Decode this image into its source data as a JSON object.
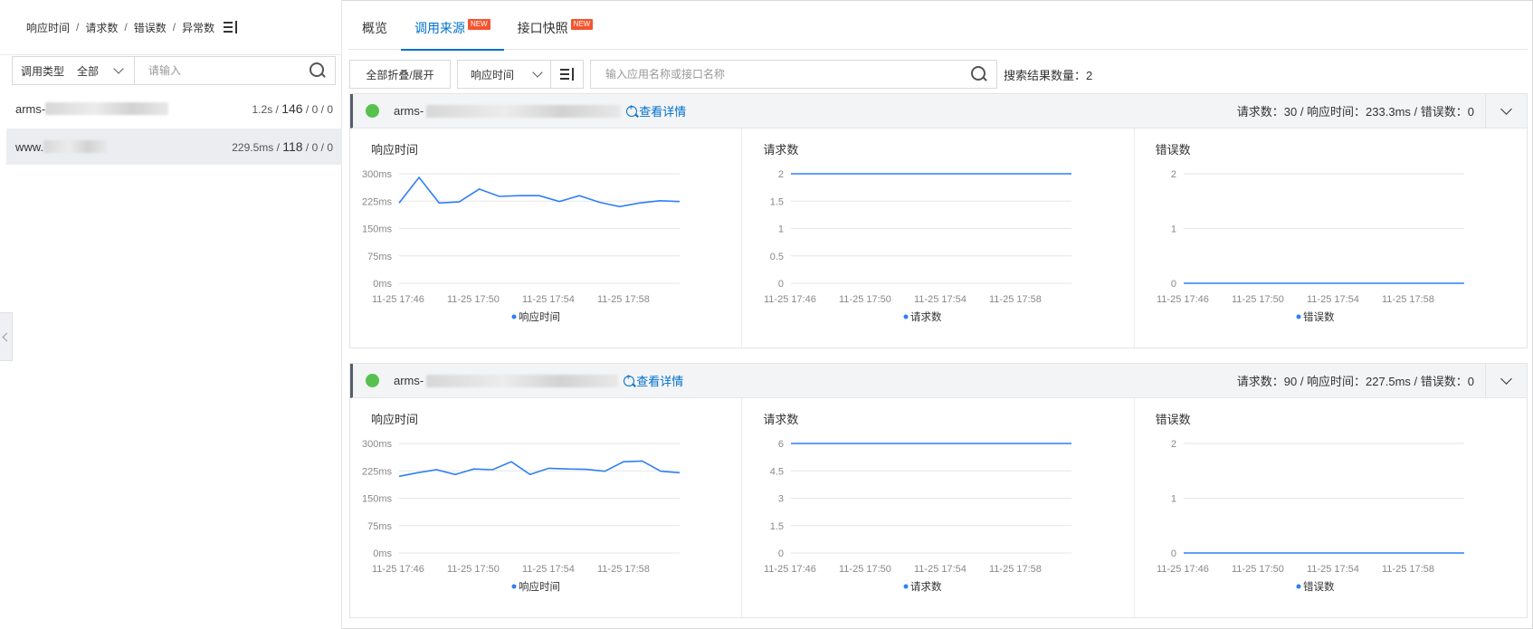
{
  "left": {
    "header": {
      "items": [
        "响应时间",
        "请求数",
        "错误数",
        "异常数"
      ],
      "sep": "/"
    },
    "filter": {
      "type_label": "调用类型",
      "type_value": "全部",
      "placeholder": "请输入"
    },
    "apps": [
      {
        "name_prefix": "arms-",
        "rt": "1.2s",
        "req": "146",
        "err": "0",
        "exc": "0",
        "selected": false
      },
      {
        "name_prefix": "www.",
        "rt": "229.5ms",
        "req": "118",
        "err": "0",
        "exc": "0",
        "selected": true
      }
    ]
  },
  "tabs": [
    {
      "label": "概览",
      "new": ""
    },
    {
      "label": "调用来源",
      "new": "NEW"
    },
    {
      "label": "接口快照",
      "new": "NEW"
    }
  ],
  "toolbar": {
    "fold_label": "全部折叠/展开",
    "sort_value": "响应时间",
    "search_placeholder": "输入应用名称或接口名称",
    "result_label": "搜索结果数量：",
    "result_count": "2"
  },
  "cards": [
    {
      "name_prefix": "arms-",
      "detail_label": "查看详情",
      "stats": "请求数：30 / 响应时间：233.3ms / 错误数：0",
      "charts": [
        {
          "title": "响应时间",
          "legend": "响应时间"
        },
        {
          "title": "请求数",
          "legend": "请求数"
        },
        {
          "title": "错误数",
          "legend": "错误数"
        }
      ]
    },
    {
      "name_prefix": "arms-",
      "detail_label": "查看详情",
      "stats": "请求数：90 / 响应时间：227.5ms / 错误数：0",
      "charts": [
        {
          "title": "响应时间",
          "legend": "响应时间"
        },
        {
          "title": "请求数",
          "legend": "请求数"
        },
        {
          "title": "错误数",
          "legend": "错误数"
        }
      ]
    }
  ],
  "chart_data": [
    {
      "type": "line",
      "title": "响应时间",
      "x": [
        "11-25 17:46",
        "11-25 17:47",
        "11-25 17:48",
        "11-25 17:49",
        "11-25 17:50",
        "11-25 17:51",
        "11-25 17:52",
        "11-25 17:53",
        "11-25 17:54",
        "11-25 17:55",
        "11-25 17:56",
        "11-25 17:57",
        "11-25 17:58",
        "11-25 17:59",
        "11-25 18:00"
      ],
      "xticks": [
        "11-25 17:46",
        "11-25 17:50",
        "11-25 17:54",
        "11-25 17:58"
      ],
      "series": [
        {
          "name": "响应时间",
          "values": [
            220,
            290,
            220,
            223,
            258,
            238,
            240,
            240,
            224,
            240,
            222,
            210,
            220,
            226,
            224
          ]
        }
      ],
      "yticks": [
        "0ms",
        "75ms",
        "150ms",
        "225ms",
        "300ms"
      ],
      "ylim": [
        0,
        300
      ],
      "color": "#2f7ff5"
    },
    {
      "type": "line",
      "title": "请求数",
      "x": [
        "11-25 17:46",
        "11-25 17:47",
        "11-25 17:48",
        "11-25 17:49",
        "11-25 17:50",
        "11-25 17:51",
        "11-25 17:52",
        "11-25 17:53",
        "11-25 17:54",
        "11-25 17:55",
        "11-25 17:56",
        "11-25 17:57",
        "11-25 17:58",
        "11-25 17:59",
        "11-25 18:00"
      ],
      "xticks": [
        "11-25 17:46",
        "11-25 17:50",
        "11-25 17:54",
        "11-25 17:58"
      ],
      "series": [
        {
          "name": "请求数",
          "values": [
            2,
            2,
            2,
            2,
            2,
            2,
            2,
            2,
            2,
            2,
            2,
            2,
            2,
            2,
            2
          ]
        }
      ],
      "yticks": [
        "0",
        "0.5",
        "1",
        "1.5",
        "2"
      ],
      "ylim": [
        0,
        2
      ],
      "color": "#2f7ff5"
    },
    {
      "type": "line",
      "title": "错误数",
      "x": [
        "11-25 17:46",
        "11-25 17:47",
        "11-25 17:48",
        "11-25 17:49",
        "11-25 17:50",
        "11-25 17:51",
        "11-25 17:52",
        "11-25 17:53",
        "11-25 17:54",
        "11-25 17:55",
        "11-25 17:56",
        "11-25 17:57",
        "11-25 17:58",
        "11-25 17:59",
        "11-25 18:00"
      ],
      "xticks": [
        "11-25 17:46",
        "11-25 17:50",
        "11-25 17:54",
        "11-25 17:58"
      ],
      "series": [
        {
          "name": "错误数",
          "values": [
            0,
            0,
            0,
            0,
            0,
            0,
            0,
            0,
            0,
            0,
            0,
            0,
            0,
            0,
            0
          ]
        }
      ],
      "yticks": [
        "0",
        "1",
        "2"
      ],
      "ylim": [
        0,
        2
      ],
      "color": "#2f7ff5"
    },
    {
      "type": "line",
      "title": "响应时间",
      "x": [
        "11-25 17:46",
        "11-25 17:47",
        "11-25 17:48",
        "11-25 17:49",
        "11-25 17:50",
        "11-25 17:51",
        "11-25 17:52",
        "11-25 17:53",
        "11-25 17:54",
        "11-25 17:55",
        "11-25 17:56",
        "11-25 17:57",
        "11-25 17:58",
        "11-25 17:59",
        "11-25 18:00"
      ],
      "xticks": [
        "11-25 17:46",
        "11-25 17:50",
        "11-25 17:54",
        "11-25 17:58"
      ],
      "series": [
        {
          "name": "响应时间",
          "values": [
            210,
            220,
            228,
            215,
            230,
            228,
            250,
            215,
            232,
            230,
            229,
            224,
            250,
            252,
            224,
            220
          ]
        }
      ],
      "yticks": [
        "0ms",
        "75ms",
        "150ms",
        "225ms",
        "300ms"
      ],
      "ylim": [
        0,
        300
      ],
      "color": "#2f7ff5"
    },
    {
      "type": "line",
      "title": "请求数",
      "x": [
        "11-25 17:46",
        "11-25 17:47",
        "11-25 17:48",
        "11-25 17:49",
        "11-25 17:50",
        "11-25 17:51",
        "11-25 17:52",
        "11-25 17:53",
        "11-25 17:54",
        "11-25 17:55",
        "11-25 17:56",
        "11-25 17:57",
        "11-25 17:58",
        "11-25 17:59",
        "11-25 18:00"
      ],
      "xticks": [
        "11-25 17:46",
        "11-25 17:50",
        "11-25 17:54",
        "11-25 17:58"
      ],
      "series": [
        {
          "name": "请求数",
          "values": [
            6,
            6,
            6,
            6,
            6,
            6,
            6,
            6,
            6,
            6,
            6,
            6,
            6,
            6,
            6
          ]
        }
      ],
      "yticks": [
        "0",
        "1.5",
        "3",
        "4.5",
        "6"
      ],
      "ylim": [
        0,
        6
      ],
      "color": "#2f7ff5"
    },
    {
      "type": "line",
      "title": "错误数",
      "x": [
        "11-25 17:46",
        "11-25 17:47",
        "11-25 17:48",
        "11-25 17:49",
        "11-25 17:50",
        "11-25 17:51",
        "11-25 17:52",
        "11-25 17:53",
        "11-25 17:54",
        "11-25 17:55",
        "11-25 17:56",
        "11-25 17:57",
        "11-25 17:58",
        "11-25 17:59",
        "11-25 18:00"
      ],
      "xticks": [
        "11-25 17:46",
        "11-25 17:50",
        "11-25 17:54",
        "11-25 17:58"
      ],
      "series": [
        {
          "name": "错误数",
          "values": [
            0,
            0,
            0,
            0,
            0,
            0,
            0,
            0,
            0,
            0,
            0,
            0,
            0,
            0,
            0
          ]
        }
      ],
      "yticks": [
        "0",
        "1",
        "2"
      ],
      "ylim": [
        0,
        2
      ],
      "color": "#2f7ff5"
    }
  ]
}
